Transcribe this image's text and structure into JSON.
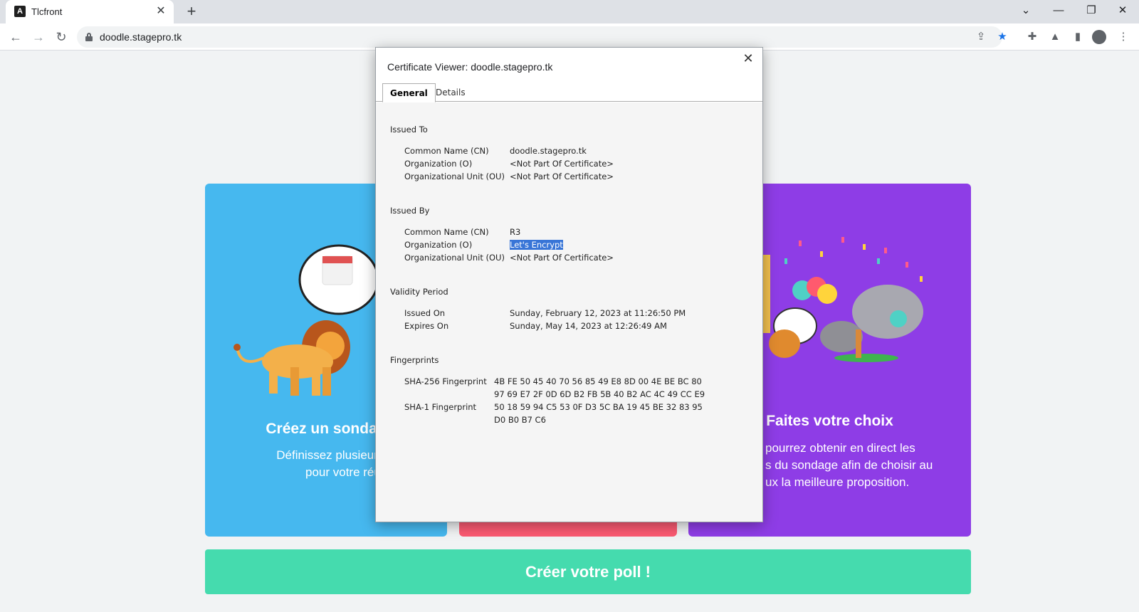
{
  "browser": {
    "tab_title": "Tlcfront",
    "tab_favicon_glyph": "A",
    "url": "doodle.stagepro.tk"
  },
  "page": {
    "card_left_title": "Créez un sondag",
    "card_left_text_1": "Définissez plusieurs cré",
    "card_left_text_2": "pour votre réunion",
    "card_right_title": "Faites votre choix",
    "card_right_text_1": "pourrez obtenir en direct les",
    "card_right_text_2": "s du sondage afin de choisir au",
    "card_right_text_3": "ux la meilleure proposition.",
    "cta_label": "Créer votre poll !",
    "colors": {
      "blue": "#46b8ef",
      "red": "#fb5a72",
      "purple": "#8e3de6",
      "green": "#45dbae"
    }
  },
  "dialog": {
    "title": "Certificate Viewer: doodle.stagepro.tk",
    "close_glyph": "✕",
    "tabs": {
      "general": "General",
      "details": "Details"
    },
    "issued_to": {
      "heading": "Issued To",
      "cn_label": "Common Name (CN)",
      "cn_value": "doodle.stagepro.tk",
      "o_label": "Organization (O)",
      "o_value": "<Not Part Of Certificate>",
      "ou_label": "Organizational Unit (OU)",
      "ou_value": "<Not Part Of Certificate>"
    },
    "issued_by": {
      "heading": "Issued By",
      "cn_label": "Common Name (CN)",
      "cn_value": "R3",
      "o_label": "Organization (O)",
      "o_value": "Let's Encrypt",
      "ou_label": "Organizational Unit (OU)",
      "ou_value": "<Not Part Of Certificate>"
    },
    "validity": {
      "heading": "Validity Period",
      "issued_label": "Issued On",
      "issued_value": "Sunday, February 12, 2023 at 11:26:50 PM",
      "expires_label": "Expires On",
      "expires_value": "Sunday, May 14, 2023 at 12:26:49 AM"
    },
    "fingerprints": {
      "heading": "Fingerprints",
      "sha256_label": "SHA-256 Fingerprint",
      "sha256_line1": "4B FE 50 45 40 70 56 85 49 E8 8D 00 4E BE BC 80",
      "sha256_line2": "97 69 E7 2F 0D 6D B2 FB 5B 40 B2 AC 4C 49 CC E9",
      "sha1_label": "SHA-1 Fingerprint",
      "sha1_line1": "50 18 59 94 C5 53 0F D3 5C BA 19 45 BE 32 83 95",
      "sha1_line2": "D0 B0 B7 C6"
    }
  }
}
